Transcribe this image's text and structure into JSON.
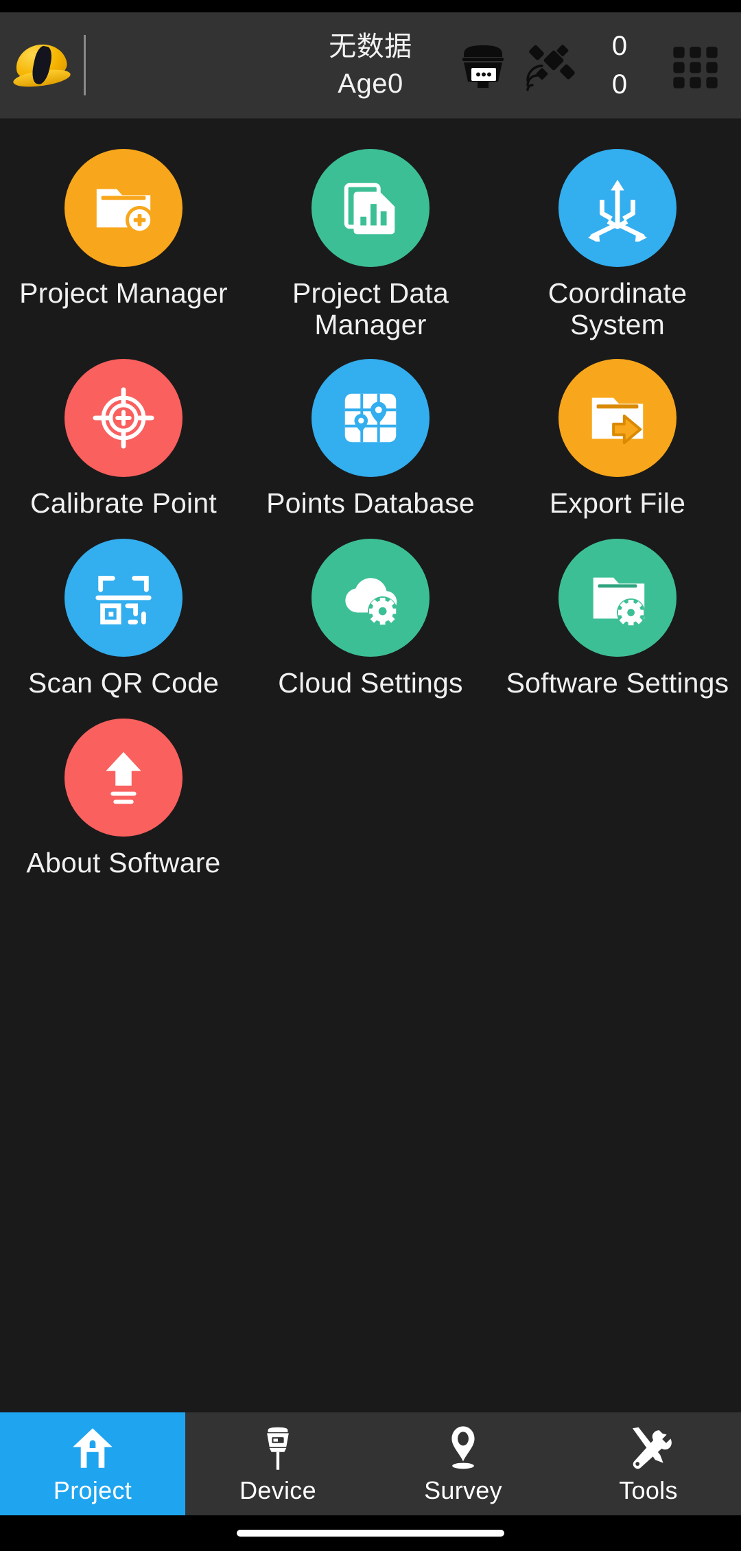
{
  "app": {
    "logo_icon": "hardhat-logo",
    "menu_icon": "grid-apps-icon"
  },
  "statusbar": {
    "data_status": "无数据",
    "age_label": "Age0",
    "receiver_icon": "gnss-receiver-icon",
    "satellite_icon": "satellite-icon",
    "count_top": "0",
    "count_bottom": "0"
  },
  "menu": {
    "items": [
      {
        "label": "Project Manager",
        "icon": "folder-add-icon",
        "color": "#F8A61B",
        "name": "project-manager"
      },
      {
        "label": "Project Data Manager",
        "icon": "documents-chart-icon",
        "color": "#3DBF96",
        "name": "project-data-manager"
      },
      {
        "label": "Coordinate System",
        "icon": "coordinate-axes-icon",
        "color": "#33AEEF",
        "name": "coordinate-system"
      },
      {
        "label": "Calibrate Point",
        "icon": "crosshair-target-icon",
        "color": "#F9605E",
        "name": "calibrate-point"
      },
      {
        "label": "Points Database",
        "icon": "map-pins-grid-icon",
        "color": "#33AEEF",
        "name": "points-database"
      },
      {
        "label": "Export File",
        "icon": "folder-export-icon",
        "color": "#F8A61B",
        "name": "export-file"
      },
      {
        "label": "Scan QR Code",
        "icon": "qr-scan-icon",
        "color": "#33AEEF",
        "name": "scan-qr-code"
      },
      {
        "label": "Cloud Settings",
        "icon": "cloud-gear-icon",
        "color": "#3DBF96",
        "name": "cloud-settings"
      },
      {
        "label": "Software Settings",
        "icon": "folder-gear-icon",
        "color": "#3DBF96",
        "name": "software-settings"
      },
      {
        "label": "About Software",
        "icon": "upload-arrow-icon",
        "color": "#F9605E",
        "name": "about-software"
      }
    ]
  },
  "bottom_nav": {
    "active_color": "#1FA5F0",
    "items": [
      {
        "label": "Project",
        "icon": "home-icon",
        "active": true
      },
      {
        "label": "Device",
        "icon": "rover-pole-icon",
        "active": false
      },
      {
        "label": "Survey",
        "icon": "map-pin-icon",
        "active": false
      },
      {
        "label": "Tools",
        "icon": "tools-cross-icon",
        "active": false
      }
    ]
  }
}
